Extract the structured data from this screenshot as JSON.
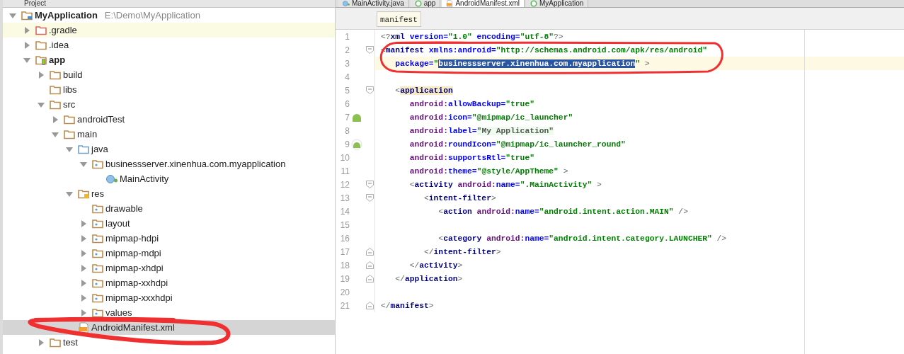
{
  "project_panel": {
    "title": "Project",
    "tree": [
      {
        "label": "MyApplication",
        "path": "E:\\Demo\\MyApplication",
        "kind": "module",
        "bold": true,
        "expanded": true,
        "selected": false,
        "hovered": false,
        "children": [
          {
            "label": ".gradle",
            "kind": "excluded-folder",
            "bold": false,
            "expanded": false,
            "selected": false,
            "hovered": true
          },
          {
            "label": ".idea",
            "kind": "folder",
            "bold": false,
            "expanded": false,
            "selected": false,
            "hovered": false
          },
          {
            "label": "app",
            "kind": "android-module",
            "bold": true,
            "expanded": true,
            "selected": false,
            "hovered": false,
            "children": [
              {
                "label": "build",
                "kind": "folder",
                "bold": false,
                "expanded": false,
                "selected": false,
                "hovered": false
              },
              {
                "label": "libs",
                "kind": "folder",
                "bold": false,
                "selected": false,
                "hovered": false
              },
              {
                "label": "src",
                "kind": "folder",
                "bold": false,
                "expanded": true,
                "selected": false,
                "hovered": false,
                "children": [
                  {
                    "label": "androidTest",
                    "kind": "folder",
                    "bold": false,
                    "expanded": false,
                    "selected": false,
                    "hovered": false
                  },
                  {
                    "label": "main",
                    "kind": "folder",
                    "bold": false,
                    "expanded": true,
                    "selected": false,
                    "hovered": false,
                    "children": [
                      {
                        "label": "java",
                        "kind": "source-folder",
                        "bold": false,
                        "expanded": true,
                        "selected": false,
                        "hovered": false,
                        "children": [
                          {
                            "label": "businessserver.xinenhua.com.myapplication",
                            "kind": "package",
                            "bold": false,
                            "expanded": true,
                            "selected": false,
                            "hovered": false,
                            "children": [
                              {
                                "label": "MainActivity",
                                "kind": "class",
                                "bold": false,
                                "selected": false,
                                "hovered": false
                              }
                            ]
                          }
                        ]
                      },
                      {
                        "label": "res",
                        "kind": "resource-root",
                        "bold": false,
                        "expanded": true,
                        "selected": false,
                        "hovered": false,
                        "children": [
                          {
                            "label": "drawable",
                            "kind": "package",
                            "bold": false,
                            "selected": false,
                            "hovered": false
                          },
                          {
                            "label": "layout",
                            "kind": "package",
                            "bold": false,
                            "expanded": false,
                            "selected": false,
                            "hovered": false
                          },
                          {
                            "label": "mipmap-hdpi",
                            "kind": "package",
                            "bold": false,
                            "expanded": false,
                            "selected": false,
                            "hovered": false
                          },
                          {
                            "label": "mipmap-mdpi",
                            "kind": "package",
                            "bold": false,
                            "expanded": false,
                            "selected": false,
                            "hovered": false
                          },
                          {
                            "label": "mipmap-xhdpi",
                            "kind": "package",
                            "bold": false,
                            "expanded": false,
                            "selected": false,
                            "hovered": false
                          },
                          {
                            "label": "mipmap-xxhdpi",
                            "kind": "package",
                            "bold": false,
                            "expanded": false,
                            "selected": false,
                            "hovered": false
                          },
                          {
                            "label": "mipmap-xxxhdpi",
                            "kind": "package",
                            "bold": false,
                            "expanded": false,
                            "selected": false,
                            "hovered": false
                          },
                          {
                            "label": "values",
                            "kind": "package",
                            "bold": false,
                            "expanded": false,
                            "selected": false,
                            "hovered": false
                          }
                        ]
                      },
                      {
                        "label": "AndroidManifest.xml",
                        "kind": "manifest",
                        "bold": false,
                        "selected": true,
                        "hovered": false
                      }
                    ]
                  }
                ]
              },
              {
                "label": "test",
                "kind": "folder",
                "bold": false,
                "expanded": false,
                "selected": false,
                "hovered": false
              }
            ]
          }
        ]
      }
    ]
  },
  "editor": {
    "tabs": [
      {
        "label": "MainActivity.java",
        "kind": "class",
        "selected": false
      },
      {
        "label": "app",
        "kind": "gradle",
        "selected": false
      },
      {
        "label": "AndroidManifest.xml",
        "kind": "manifest",
        "selected": true
      },
      {
        "label": "MyApplication",
        "kind": "gradle",
        "selected": false
      }
    ],
    "breadcrumb": "manifest",
    "lines": [
      {
        "number": "1",
        "kind": "plain",
        "current": false,
        "tokens": [
          {
            "kind": "punct",
            "text": "<?"
          },
          {
            "kind": "tag",
            "text": "xml"
          },
          {
            "kind": "attr",
            "text": " version="
          },
          {
            "kind": "value",
            "text": "\"1.0\""
          },
          {
            "kind": "attr",
            "text": " encoding="
          },
          {
            "kind": "value",
            "text": "\"utf-8\""
          },
          {
            "kind": "punct",
            "text": "?>"
          }
        ]
      },
      {
        "number": "2",
        "kind": "fold-start",
        "current": false,
        "tokens": [
          {
            "kind": "punct",
            "text": "<"
          },
          {
            "kind": "tag",
            "text": "manifest"
          },
          {
            "kind": "attr",
            "text": " xmlns:android="
          },
          {
            "kind": "value",
            "text": "\"http://schemas.android.com/apk/res/android\""
          }
        ]
      },
      {
        "number": "3",
        "kind": "plain",
        "current": true,
        "tokens": [
          {
            "kind": "attr",
            "text": "   package="
          },
          {
            "kind": "value",
            "text": "\""
          },
          {
            "kind": "selection",
            "text": "businessserver.xinenhua.com.myapplication"
          },
          {
            "kind": "value",
            "text": "\""
          },
          {
            "kind": "punct",
            "text": " >"
          }
        ]
      },
      {
        "number": "4",
        "kind": "plain",
        "current": false
      },
      {
        "number": "5",
        "kind": "fold-start",
        "current": false,
        "tokens": [
          {
            "kind": "punct",
            "text": "   <"
          },
          {
            "kind": "match",
            "text": "application"
          }
        ]
      },
      {
        "number": "6",
        "kind": "plain",
        "current": false,
        "tokens": [
          {
            "kind": "ns",
            "text": "      android:"
          },
          {
            "kind": "attr",
            "text": "allowBackup="
          },
          {
            "kind": "value",
            "text": "\"true\""
          }
        ]
      },
      {
        "number": "7",
        "kind": "android-icon",
        "current": false,
        "tokens": [
          {
            "kind": "ns",
            "text": "      android:"
          },
          {
            "kind": "attr",
            "text": "icon="
          },
          {
            "kind": "value",
            "text": "\"@mipmap/ic_launcher\""
          }
        ]
      },
      {
        "number": "8",
        "kind": "plain",
        "current": false,
        "tokens": [
          {
            "kind": "ns",
            "text": "      android:"
          },
          {
            "kind": "attr",
            "text": "label="
          },
          {
            "kind": "injected",
            "text": "\"My Application\""
          }
        ]
      },
      {
        "number": "9",
        "kind": "android-round-icon",
        "current": false,
        "tokens": [
          {
            "kind": "ns",
            "text": "      android:"
          },
          {
            "kind": "attr",
            "text": "roundIcon="
          },
          {
            "kind": "value",
            "text": "\"@mipmap/ic_launcher_round\""
          }
        ]
      },
      {
        "number": "10",
        "kind": "plain",
        "current": false,
        "tokens": [
          {
            "kind": "ns",
            "text": "      android:"
          },
          {
            "kind": "attr",
            "text": "supportsRtl="
          },
          {
            "kind": "value",
            "text": "\"true\""
          }
        ]
      },
      {
        "number": "11",
        "kind": "plain",
        "current": false,
        "tokens": [
          {
            "kind": "ns",
            "text": "      android:"
          },
          {
            "kind": "attr",
            "text": "theme="
          },
          {
            "kind": "value",
            "text": "\"@style/AppTheme\""
          },
          {
            "kind": "punct",
            "text": " >"
          }
        ]
      },
      {
        "number": "12",
        "kind": "fold-start",
        "current": false,
        "tokens": [
          {
            "kind": "punct",
            "text": "      <"
          },
          {
            "kind": "tag",
            "text": "activity"
          },
          {
            "kind": "ns",
            "text": " android:"
          },
          {
            "kind": "attr",
            "text": "name="
          },
          {
            "kind": "value",
            "text": "\".MainActivity\""
          },
          {
            "kind": "punct",
            "text": " >"
          }
        ]
      },
      {
        "number": "13",
        "kind": "fold-start",
        "current": false,
        "tokens": [
          {
            "kind": "punct",
            "text": "         <"
          },
          {
            "kind": "tag",
            "text": "intent-filter"
          },
          {
            "kind": "punct",
            "text": ">"
          }
        ]
      },
      {
        "number": "14",
        "kind": "plain",
        "current": false,
        "tokens": [
          {
            "kind": "punct",
            "text": "            <"
          },
          {
            "kind": "tag",
            "text": "action"
          },
          {
            "kind": "ns",
            "text": " android:"
          },
          {
            "kind": "attr",
            "text": "name="
          },
          {
            "kind": "value",
            "text": "\"android.intent.action.MAIN\""
          },
          {
            "kind": "punct",
            "text": " />"
          }
        ]
      },
      {
        "number": "15",
        "kind": "plain",
        "current": false
      },
      {
        "number": "16",
        "kind": "plain",
        "current": false,
        "tokens": [
          {
            "kind": "punct",
            "text": "            <"
          },
          {
            "kind": "tag",
            "text": "category"
          },
          {
            "kind": "ns",
            "text": " android:"
          },
          {
            "kind": "attr",
            "text": "name="
          },
          {
            "kind": "value",
            "text": "\"android.intent.category.LAUNCHER\""
          },
          {
            "kind": "punct",
            "text": " />"
          }
        ]
      },
      {
        "number": "17",
        "kind": "fold-end",
        "current": false,
        "tokens": [
          {
            "kind": "punct",
            "text": "         </"
          },
          {
            "kind": "tag",
            "text": "intent-filter"
          },
          {
            "kind": "punct",
            "text": ">"
          }
        ]
      },
      {
        "number": "18",
        "kind": "fold-end",
        "current": false,
        "tokens": [
          {
            "kind": "punct",
            "text": "      </"
          },
          {
            "kind": "tag",
            "text": "activity"
          },
          {
            "kind": "punct",
            "text": ">"
          }
        ]
      },
      {
        "number": "19",
        "kind": "fold-end",
        "current": false,
        "tokens": [
          {
            "kind": "punct",
            "text": "   </"
          },
          {
            "kind": "tag",
            "text": "application"
          },
          {
            "kind": "punct",
            "text": ">"
          }
        ]
      },
      {
        "number": "20",
        "kind": "plain",
        "current": false
      },
      {
        "number": "21",
        "kind": "fold-end",
        "current": false,
        "tokens": [
          {
            "kind": "punct",
            "text": "</"
          },
          {
            "kind": "tag",
            "text": "manifest"
          },
          {
            "kind": "punct",
            "text": ">"
          }
        ]
      }
    ]
  },
  "annotations": [
    {
      "kind": "scribble"
    },
    {
      "kind": "scribble"
    }
  ]
}
